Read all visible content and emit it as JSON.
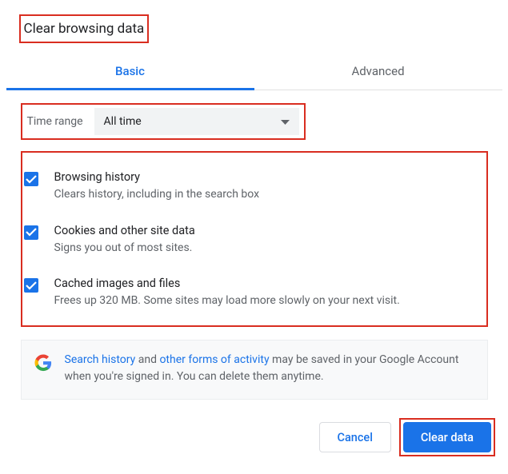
{
  "title": "Clear browsing data",
  "tabs": {
    "basic": "Basic",
    "advanced": "Advanced"
  },
  "timeRange": {
    "label": "Time range",
    "value": "All time"
  },
  "options": [
    {
      "title": "Browsing history",
      "sub": "Clears history, including in the search box"
    },
    {
      "title": "Cookies and other site data",
      "sub": "Signs you out of most sites."
    },
    {
      "title": "Cached images and files",
      "sub": "Frees up 320 MB. Some sites may load more slowly on your next visit."
    }
  ],
  "info": {
    "link1": "Search history",
    "mid1": " and ",
    "link2": "other forms of activity",
    "rest": " may be saved in your Google Account when you're signed in. You can delete them anytime."
  },
  "buttons": {
    "cancel": "Cancel",
    "clear": "Clear data"
  }
}
